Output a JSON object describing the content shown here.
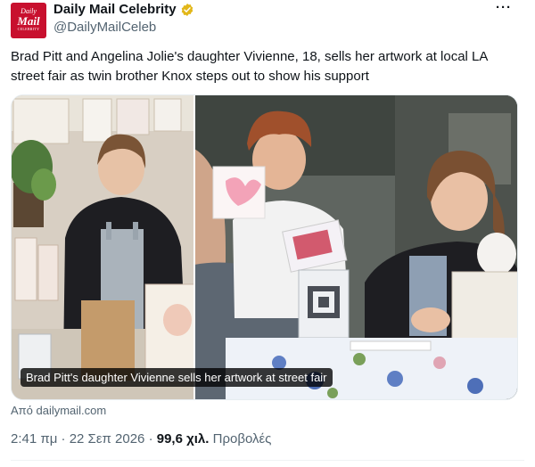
{
  "account": {
    "avatar_line1": "Daily",
    "avatar_line2": "Mail",
    "avatar_line3": "CELEBRITY",
    "display_name": "Daily Mail Celebrity",
    "handle": "@DailyMailCeleb",
    "verified_color": "#e2b719"
  },
  "more_label": "···",
  "tweet": {
    "text": "Brad Pitt and Angelina Jolie's daughter Vivienne, 18, sells her artwork at local LA street fair as twin brother Knox steps out to show his support"
  },
  "media": {
    "caption": "Brad Pitt's daughter Vivienne sells her artwork at street fair"
  },
  "source": "Από dailymail.com",
  "meta": {
    "time": "2:41 πμ",
    "separator": " · ",
    "date": "22 Σεπ 2026",
    "views_count": "99,6 χιλ.",
    "views_label": " Προβολές"
  },
  "colors": {
    "brand_red": "#c8102e",
    "text_primary": "#0f1419",
    "text_secondary": "#536471"
  },
  "icons": [
    "verified-badge-icon",
    "more-icon"
  ]
}
